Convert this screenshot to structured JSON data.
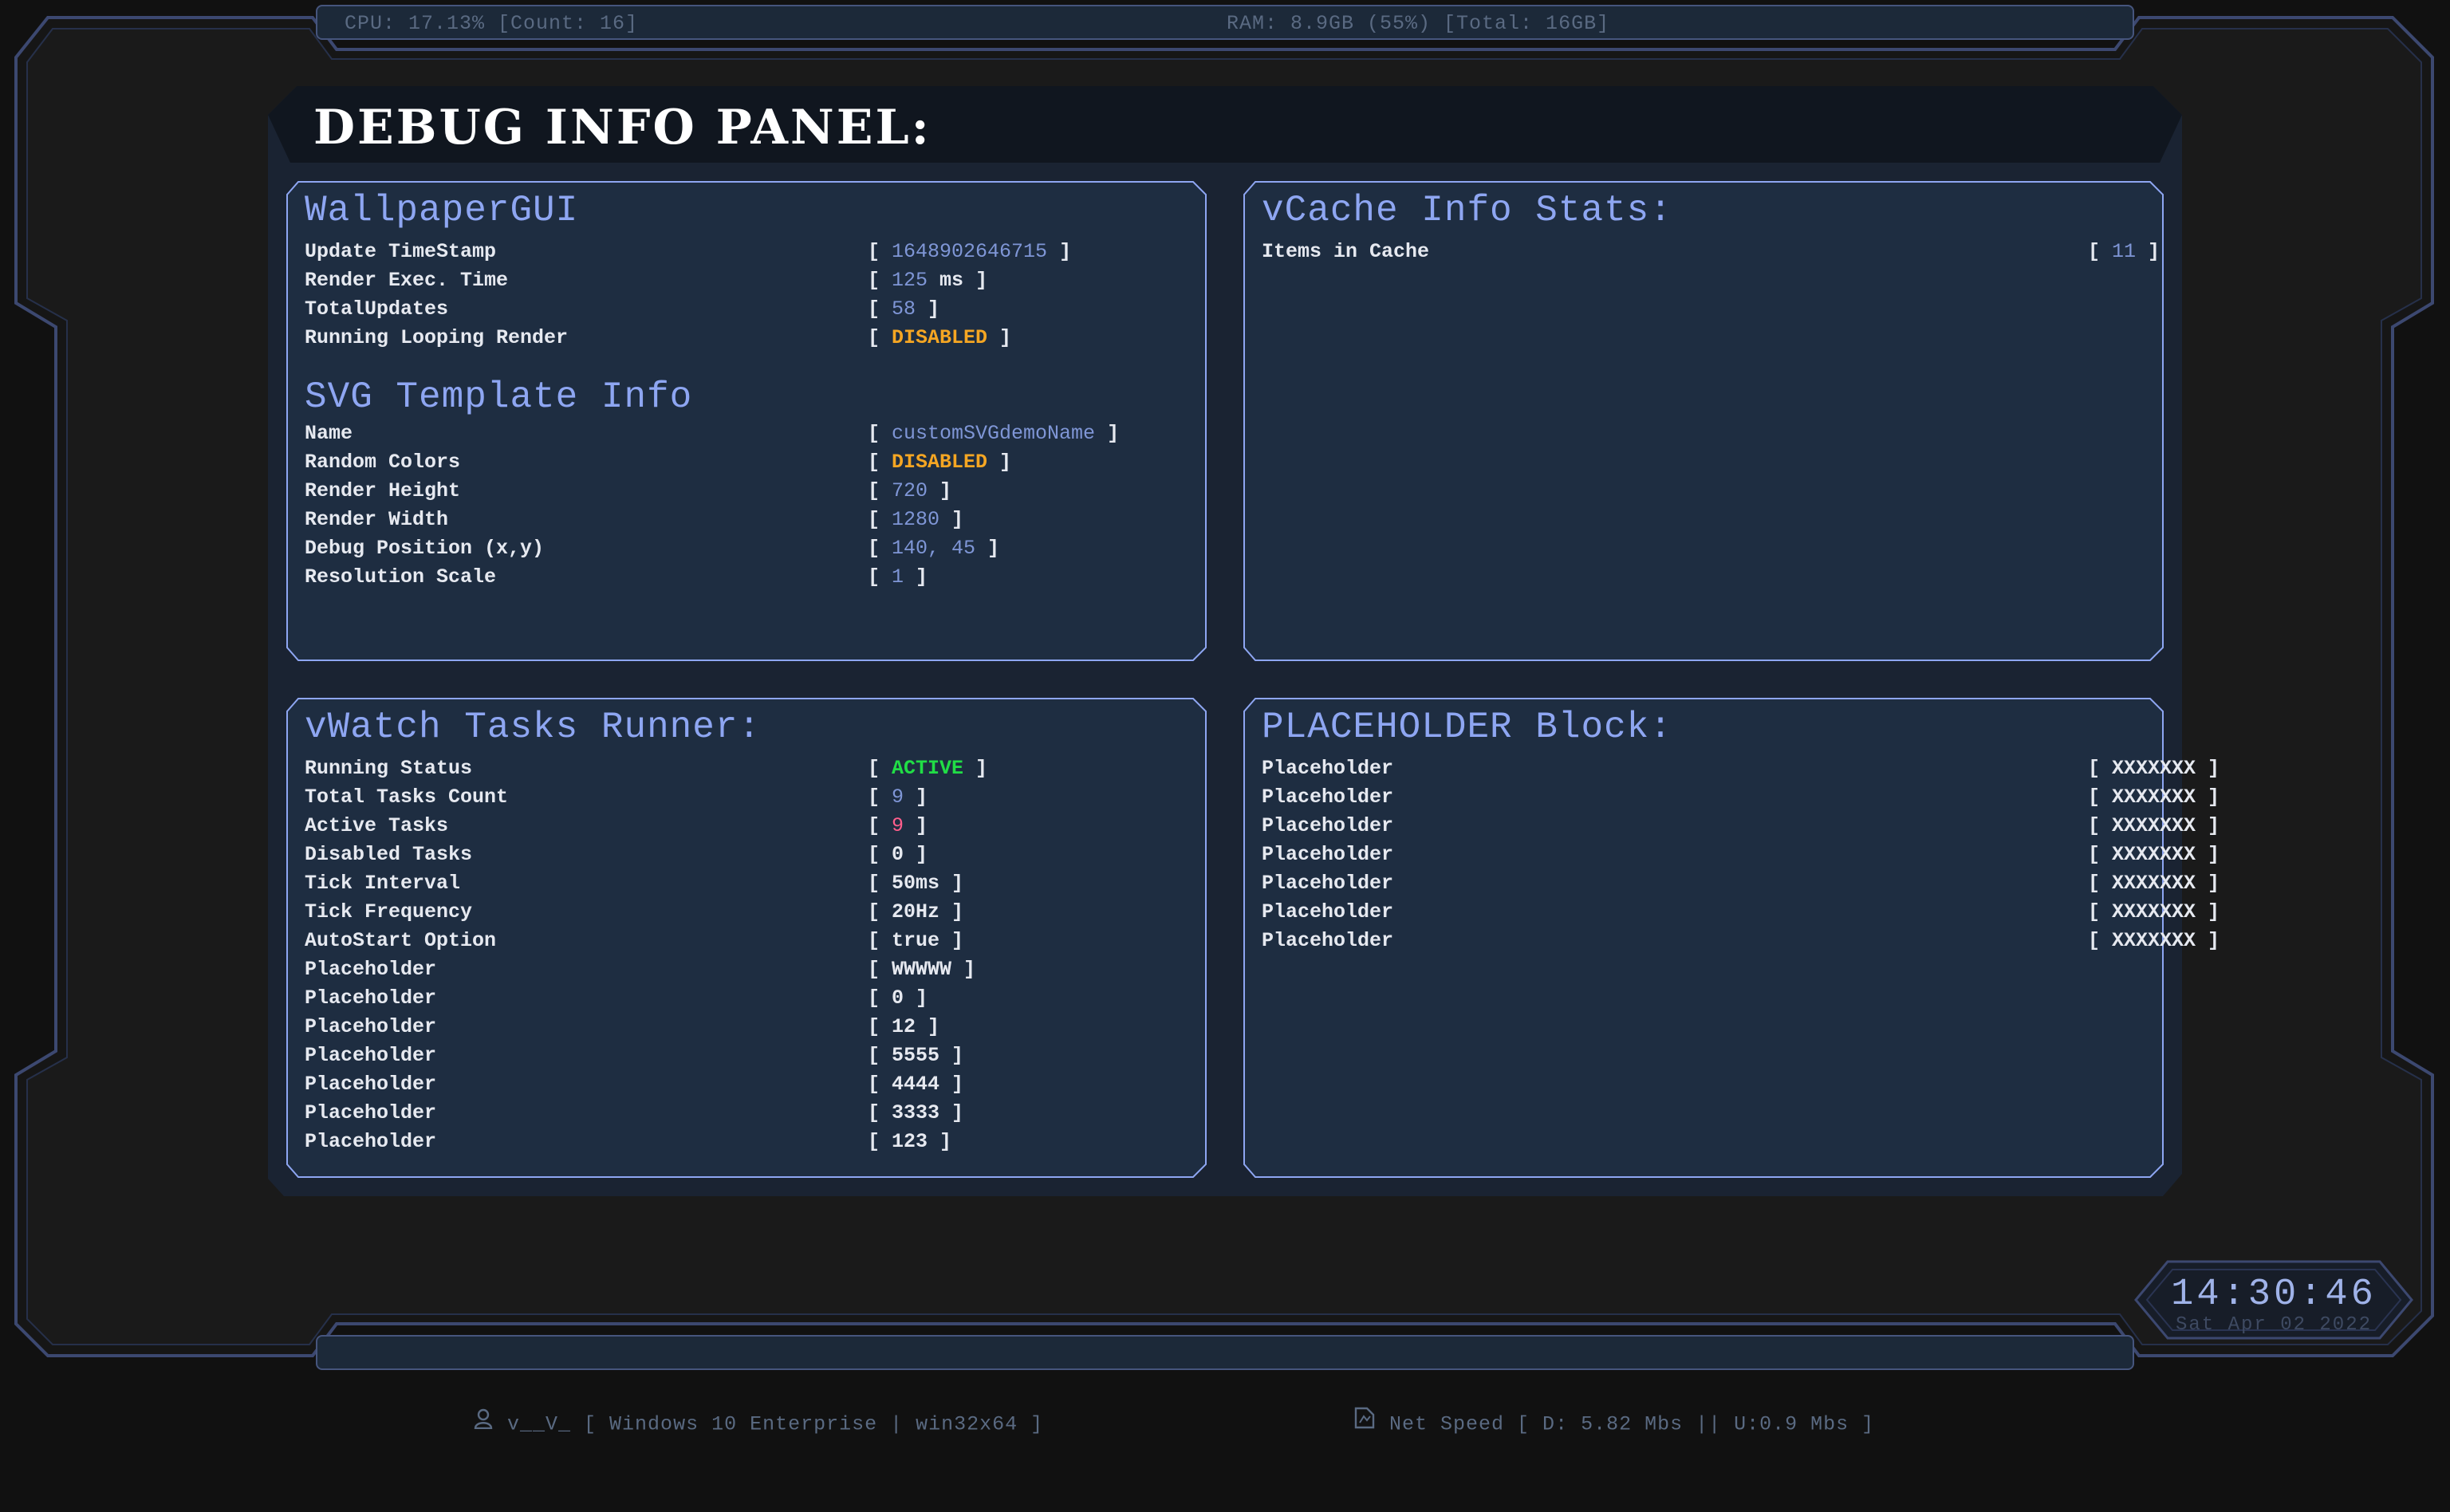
{
  "top_bar": {
    "cpu": "CPU: 17.13% [Count: 16]",
    "ram": "RAM: 8.9GB (55%) [Total: 16GB]"
  },
  "panel": {
    "title": "DEBUG INFO PANEL:"
  },
  "wallpaper_gui": {
    "title": "WallpaperGUI",
    "rows": [
      {
        "label": "Update TimeStamp",
        "value": "1648902646715",
        "color": "#7f96d6"
      },
      {
        "label": "Render Exec. Time",
        "value": "125",
        "unit": "ms",
        "color": "#7f96d6"
      },
      {
        "label": "TotalUpdates",
        "value": "58",
        "color": "#7f96d6"
      },
      {
        "label": "Running Looping Render",
        "value": "DISABLED",
        "color": "#f5a623"
      }
    ]
  },
  "svg_template": {
    "title": "SVG Template Info",
    "rows": [
      {
        "label": "Name",
        "value": "customSVGdemoName",
        "color": "#7f96d6"
      },
      {
        "label": "Random Colors",
        "value": "DISABLED",
        "color": "#f5a623"
      },
      {
        "label": "Render Height",
        "value": "720",
        "color": "#7f96d6"
      },
      {
        "label": "Render Width",
        "value": "1280",
        "color": "#7f96d6"
      },
      {
        "label": "Debug Position (x,y)",
        "value": "140, 45",
        "color": "#7f96d6"
      },
      {
        "label": "Resolution Scale",
        "value": "1",
        "color": "#7f96d6"
      }
    ]
  },
  "vcache": {
    "title": "vCache Info Stats:",
    "rows": [
      {
        "label": "Items in Cache",
        "value": "11",
        "color": "#7f96d6"
      }
    ]
  },
  "vwatch": {
    "title": "vWatch Tasks Runner:",
    "rows": [
      {
        "label": "Running Status",
        "value": "ACTIVE",
        "color": "#21dd46"
      },
      {
        "label": "Total Tasks Count",
        "value": "9",
        "color": "#7f96d6"
      },
      {
        "label": "Active Tasks",
        "value": "9",
        "color": "#ff5e8c"
      },
      {
        "label": "Disabled Tasks",
        "value": "0",
        "color": "#e6e9f0"
      },
      {
        "label": "Tick Interval",
        "value": "50ms",
        "color": "#e6e9f0"
      },
      {
        "label": "Tick Frequency",
        "value": "20Hz",
        "color": "#e6e9f0"
      },
      {
        "label": "AutoStart Option",
        "value": "true",
        "color": "#e6e9f0"
      },
      {
        "label": "Placeholder",
        "value": "WWWWW",
        "color": "#e6e9f0"
      },
      {
        "label": "Placeholder",
        "value": "0",
        "color": "#e6e9f0"
      },
      {
        "label": "Placeholder",
        "value": "12",
        "color": "#e6e9f0"
      },
      {
        "label": "Placeholder",
        "value": "5555",
        "color": "#e6e9f0"
      },
      {
        "label": "Placeholder",
        "value": "4444",
        "color": "#e6e9f0"
      },
      {
        "label": "Placeholder",
        "value": "3333",
        "color": "#e6e9f0"
      },
      {
        "label": "Placeholder",
        "value": "123",
        "color": "#e6e9f0"
      }
    ]
  },
  "placeholder_block": {
    "title": "PLACEHOLDER Block:",
    "rows": [
      {
        "label": "Placeholder",
        "value": "XXXXXXX",
        "color": "#e6e9f0"
      },
      {
        "label": "Placeholder",
        "value": "XXXXXXX",
        "color": "#e6e9f0"
      },
      {
        "label": "Placeholder",
        "value": "XXXXXXX",
        "color": "#e6e9f0"
      },
      {
        "label": "Placeholder",
        "value": "XXXXXXX",
        "color": "#e6e9f0"
      },
      {
        "label": "Placeholder",
        "value": "XXXXXXX",
        "color": "#e6e9f0"
      },
      {
        "label": "Placeholder",
        "value": "XXXXXXX",
        "color": "#e6e9f0"
      },
      {
        "label": "Placeholder",
        "value": "XXXXXXX",
        "color": "#e6e9f0"
      }
    ]
  },
  "bottom_bar": {
    "user_icon": "user-icon",
    "system": "v__V_ [ Windows 10 Enterprise | win32x64 ]",
    "net_icon": "network-icon",
    "net": "Net Speed [ D: 5.82 Mbs || U:0.9 Mbs ]"
  },
  "clock": {
    "time": "14:30:46",
    "date": "Sat Apr 02 2022"
  },
  "colors": {
    "accent": "#8ea6f2",
    "value_blue": "#7f96d6",
    "disabled": "#f5a623",
    "active": "#21dd46",
    "highlight": "#ff5e8c"
  }
}
